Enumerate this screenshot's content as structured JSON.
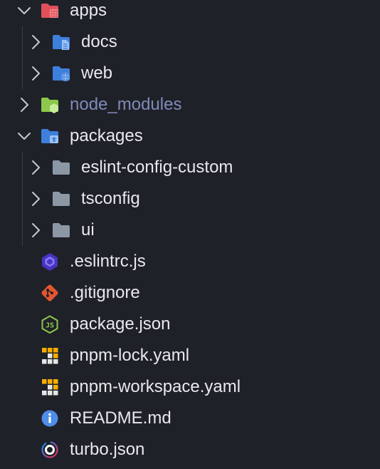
{
  "tree": [
    {
      "label": "apps",
      "type": "folder",
      "expanded": true,
      "icon": "apps-folder-icon",
      "color": "#e0505a"
    },
    {
      "label": "docs",
      "type": "folder",
      "expanded": false,
      "icon": "docs-folder-icon",
      "color": "#3e7fdc"
    },
    {
      "label": "web",
      "type": "folder",
      "expanded": false,
      "icon": "web-folder-icon",
      "color": "#3e7fdc"
    },
    {
      "label": "node_modules",
      "type": "folder",
      "expanded": false,
      "icon": "node-folder-icon",
      "color": "#8cc84b",
      "muted": true
    },
    {
      "label": "packages",
      "type": "folder",
      "expanded": true,
      "icon": "packages-folder-icon",
      "color": "#3e7fdc"
    },
    {
      "label": "eslint-config-custom",
      "type": "folder",
      "expanded": false,
      "icon": "folder-icon",
      "color": "#8c97a6"
    },
    {
      "label": "tsconfig",
      "type": "folder",
      "expanded": false,
      "icon": "folder-icon",
      "color": "#8c97a6"
    },
    {
      "label": "ui",
      "type": "folder",
      "expanded": false,
      "icon": "folder-icon",
      "color": "#8c97a6"
    },
    {
      "label": ".eslintrc.js",
      "type": "file",
      "icon": "eslint-icon",
      "color": "#4b32c3"
    },
    {
      "label": ".gitignore",
      "type": "file",
      "icon": "git-icon",
      "color": "#e45630"
    },
    {
      "label": "package.json",
      "type": "file",
      "icon": "nodejs-icon",
      "color": "#8cc84b"
    },
    {
      "label": "pnpm-lock.yaml",
      "type": "file",
      "icon": "pnpm-icon",
      "color": "#f9ad00"
    },
    {
      "label": "pnpm-workspace.yaml",
      "type": "file",
      "icon": "pnpm-icon",
      "color": "#f9ad00"
    },
    {
      "label": "README.md",
      "type": "file",
      "icon": "info-icon",
      "color": "#4e8de8"
    },
    {
      "label": "turbo.json",
      "type": "file",
      "icon": "turbo-icon",
      "color": "#ffffff"
    }
  ]
}
